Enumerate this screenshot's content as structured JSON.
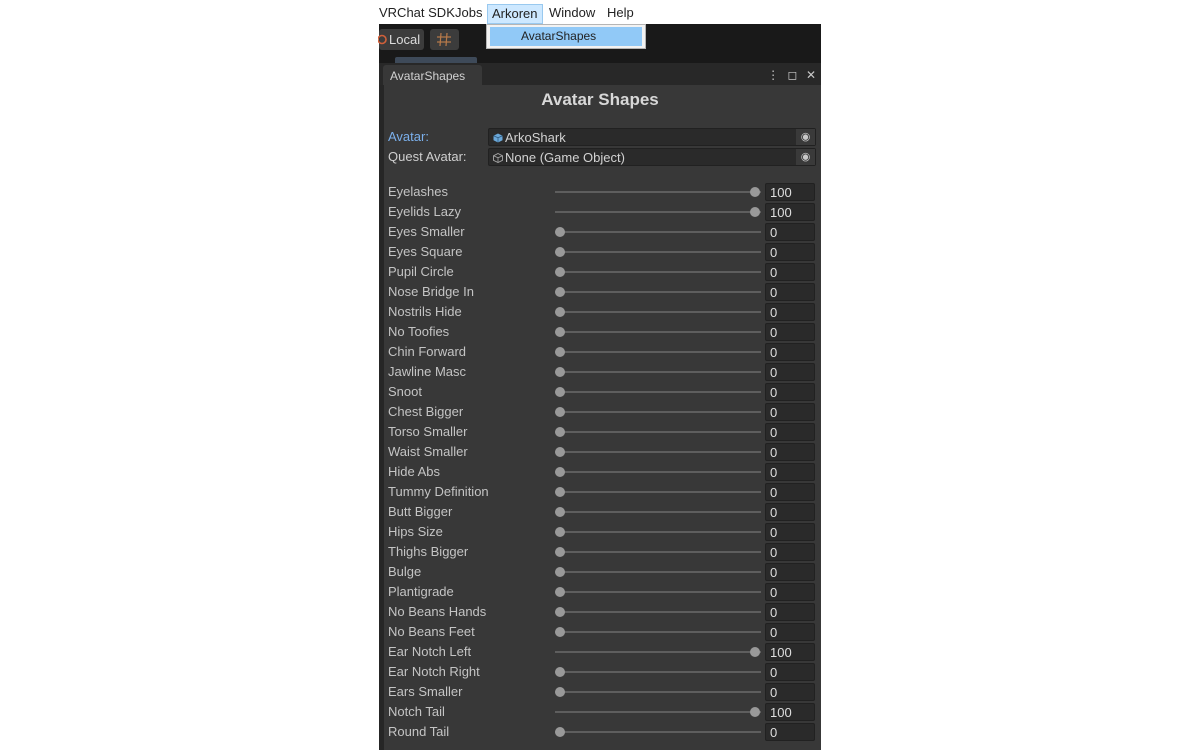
{
  "menu": {
    "items": [
      "VRChat SDK",
      "Jobs",
      "Arkoren",
      "Window",
      "Help"
    ],
    "active_index": 2,
    "dropdown_item": "AvatarShapes"
  },
  "toolbar": {
    "local_label": "Local",
    "grid_icon": "grid-icon"
  },
  "window": {
    "tab_label": "AvatarShapes",
    "title": "Avatar Shapes"
  },
  "fields": {
    "avatar_label": "Avatar:",
    "avatar_value": "ArkoShark",
    "quest_label": "Quest Avatar:",
    "quest_value": "None (Game Object)"
  },
  "colors": {
    "window_bg": "#383838",
    "field_bg": "#2a2a2a",
    "accent_label": "#7bb0ec",
    "menu_highlight": "#91c9f7"
  },
  "slider_max": 100,
  "sliders": [
    {
      "label": "Eyelashes",
      "value": 100
    },
    {
      "label": "Eyelids Lazy",
      "value": 100
    },
    {
      "label": "Eyes Smaller",
      "value": 0
    },
    {
      "label": "Eyes Square",
      "value": 0
    },
    {
      "label": "Pupil Circle",
      "value": 0
    },
    {
      "label": "Nose Bridge In",
      "value": 0
    },
    {
      "label": "Nostrils Hide",
      "value": 0
    },
    {
      "label": "No Toofies",
      "value": 0
    },
    {
      "label": "Chin Forward",
      "value": 0
    },
    {
      "label": "Jawline Masc",
      "value": 0
    },
    {
      "label": "Snoot",
      "value": 0
    },
    {
      "label": "Chest Bigger",
      "value": 0
    },
    {
      "label": "Torso Smaller",
      "value": 0
    },
    {
      "label": "Waist Smaller",
      "value": 0
    },
    {
      "label": "Hide Abs",
      "value": 0
    },
    {
      "label": "Tummy Definition",
      "value": 0
    },
    {
      "label": "Butt Bigger",
      "value": 0
    },
    {
      "label": "Hips Size",
      "value": 0
    },
    {
      "label": "Thighs Bigger",
      "value": 0
    },
    {
      "label": "Bulge",
      "value": 0
    },
    {
      "label": "Plantigrade",
      "value": 0
    },
    {
      "label": "No Beans Hands",
      "value": 0
    },
    {
      "label": "No Beans Feet",
      "value": 0
    },
    {
      "label": "Ear Notch Left",
      "value": 100
    },
    {
      "label": "Ear Notch Right",
      "value": 0
    },
    {
      "label": "Ears Smaller",
      "value": 0
    },
    {
      "label": "Notch Tail",
      "value": 100
    },
    {
      "label": "Round Tail",
      "value": 0
    }
  ]
}
